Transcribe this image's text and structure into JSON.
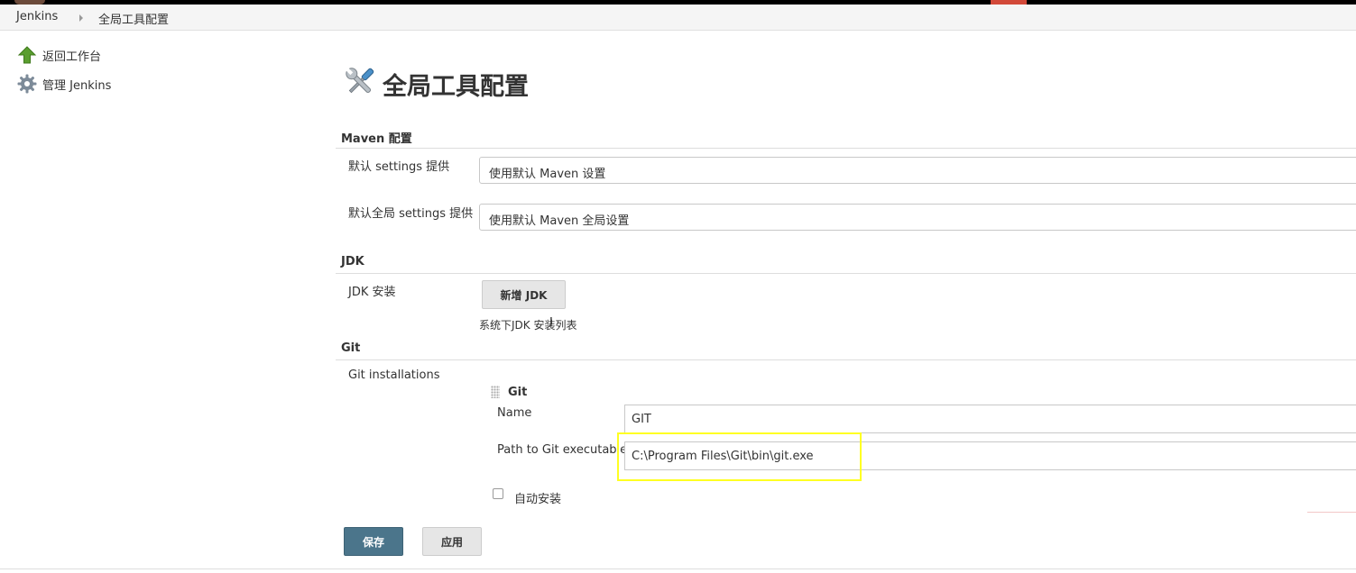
{
  "breadcrumb": {
    "root": "Jenkins",
    "current": "全局工具配置"
  },
  "sidebar": {
    "items": [
      {
        "label": "返回工作台",
        "icon": "up-arrow-icon"
      },
      {
        "label": "管理 Jenkins",
        "icon": "gear-icon"
      }
    ]
  },
  "page": {
    "title": "全局工具配置",
    "title_icon": "tools-icon"
  },
  "maven": {
    "header": "Maven 配置",
    "settings_label": "默认 settings 提供",
    "settings_value": "使用默认 Maven 设置",
    "global_settings_label": "默认全局 settings 提供",
    "global_settings_value": "使用默认 Maven 全局设置"
  },
  "jdk": {
    "header": "JDK",
    "install_label": "JDK 安装",
    "add_button": "新增 JDK",
    "description": "系统下JDK 安装列表"
  },
  "git": {
    "header": "Git",
    "installations_label": "Git installations",
    "entry_title": "Git",
    "name_label": "Name",
    "name_value": "GIT",
    "path_label": "Path to Git executable",
    "path_value": "C:\\Program Files\\Git\\bin\\git.exe",
    "auto_install_label": "自动安装",
    "auto_install_checked": false
  },
  "actions": {
    "save": "保存",
    "apply": "应用"
  },
  "colors": {
    "save_button": "#4b758b",
    "highlight": "#ffff22",
    "accent_red": "#d24939"
  }
}
